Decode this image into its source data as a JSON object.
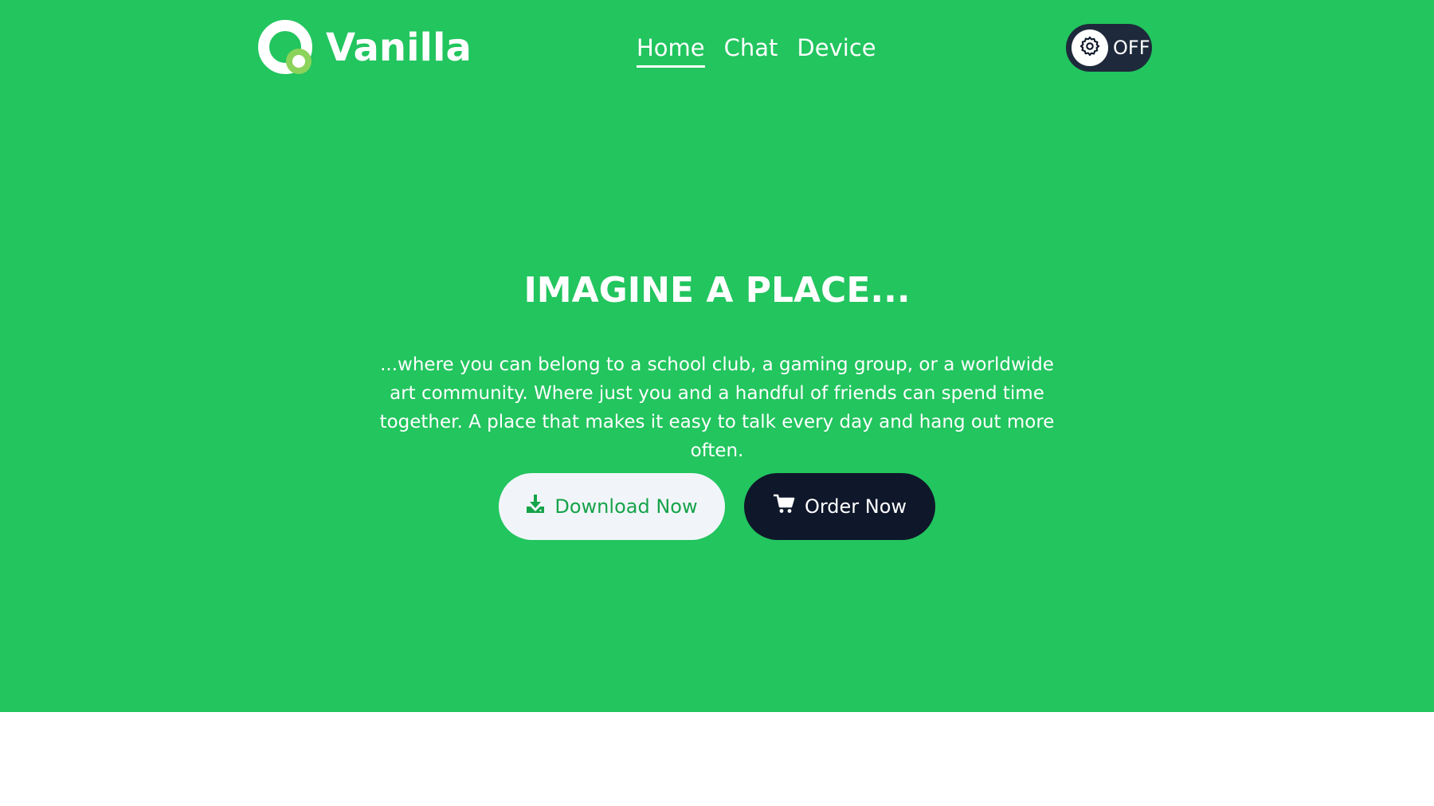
{
  "brand": {
    "name": "Vanilla",
    "logo_icon": "ring-logo-icon"
  },
  "nav": [
    {
      "label": "Home",
      "active": true
    },
    {
      "label": "Chat",
      "active": false
    },
    {
      "label": "Device",
      "active": false
    }
  ],
  "toggle": {
    "label": "OFF",
    "icon": "gear-icon"
  },
  "hero": {
    "title": "IMAGINE A PLACE...",
    "body": "...where you can belong to a school club, a gaming group, or a worldwide art community. Where just you and a handful of friends can spend time together. A place that makes it easy to talk every day and hang out more often."
  },
  "buttons": {
    "download": {
      "label": "Download Now",
      "icon": "download-icon"
    },
    "order": {
      "label": "Order Now",
      "icon": "cart-icon"
    }
  },
  "colors": {
    "hero_bg": "#22c55e",
    "dark": "#0f172a",
    "light_button": "#f1f5f9",
    "accent_text": "#16a34a",
    "logo_accent": "#8bd35a"
  }
}
